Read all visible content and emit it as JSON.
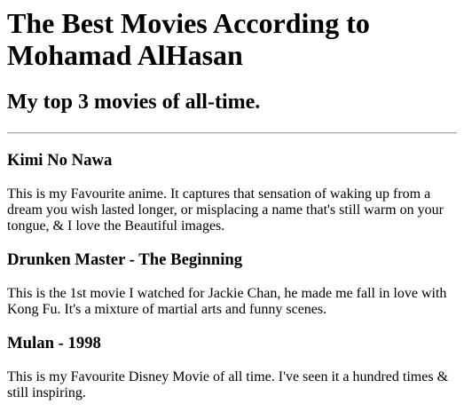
{
  "page": {
    "title": "The Best Movies According to Mohamad AlHasan",
    "subtitle": "My top 3 movies of all-time."
  },
  "movies": [
    {
      "title": "Kimi No Nawa",
      "description": "This is my Favourite anime. It captures that sensation of waking up from a dream you wish lasted longer, or misplacing a name that's still warm on your tongue, & I love the Beautiful images."
    },
    {
      "title": "Drunken Master - The Beginning",
      "description": "This is the 1st movie I watched for Jackie Chan, he made me fall in love with Kong Fu. It's a mixture of martial arts and funny scenes."
    },
    {
      "title": "Mulan - 1998",
      "description": "This is my Favourite Disney Movie of all time. I've seen it a hundred times & still inspiring."
    }
  ]
}
